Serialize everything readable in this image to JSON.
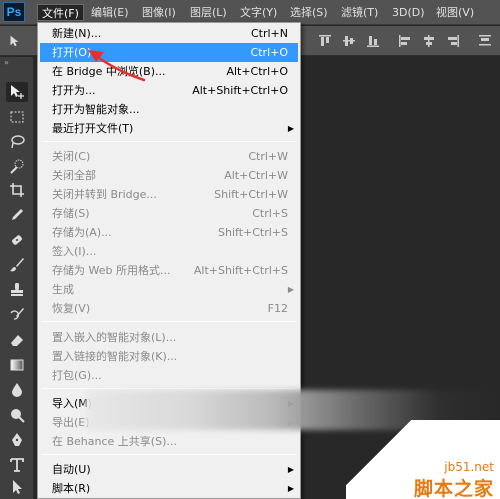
{
  "app": {
    "logo": "Ps"
  },
  "menubar": {
    "items": [
      "文件(F)",
      "编辑(E)",
      "图像(I)",
      "图层(L)",
      "文字(Y)",
      "选择(S)",
      "滤镜(T)",
      "3D(D)",
      "视图(V)"
    ]
  },
  "file_menu": {
    "groups": [
      [
        {
          "label": "新建(N)...",
          "shortcut": "Ctrl+N",
          "enabled": true
        },
        {
          "label": "打开(O)...",
          "shortcut": "Ctrl+O",
          "enabled": true,
          "highlighted": true
        },
        {
          "label": "在 Bridge 中浏览(B)...",
          "shortcut": "Alt+Ctrl+O",
          "enabled": true
        },
        {
          "label": "打开为...",
          "shortcut": "Alt+Shift+Ctrl+O",
          "enabled": true
        },
        {
          "label": "打开为智能对象...",
          "shortcut": "",
          "enabled": true
        },
        {
          "label": "最近打开文件(T)",
          "shortcut": "",
          "enabled": true,
          "submenu": true
        }
      ],
      [
        {
          "label": "关闭(C)",
          "shortcut": "Ctrl+W",
          "enabled": false
        },
        {
          "label": "关闭全部",
          "shortcut": "Alt+Ctrl+W",
          "enabled": false
        },
        {
          "label": "关闭并转到 Bridge...",
          "shortcut": "Shift+Ctrl+W",
          "enabled": false
        },
        {
          "label": "存储(S)",
          "shortcut": "Ctrl+S",
          "enabled": false
        },
        {
          "label": "存储为(A)...",
          "shortcut": "Shift+Ctrl+S",
          "enabled": false
        },
        {
          "label": "签入(I)...",
          "shortcut": "",
          "enabled": false
        },
        {
          "label": "存储为 Web 所用格式...",
          "shortcut": "Alt+Shift+Ctrl+S",
          "enabled": false
        },
        {
          "label": "生成",
          "shortcut": "",
          "enabled": false,
          "submenu": true
        },
        {
          "label": "恢复(V)",
          "shortcut": "F12",
          "enabled": false
        }
      ],
      [
        {
          "label": "置入嵌入的智能对象(L)...",
          "shortcut": "",
          "enabled": false
        },
        {
          "label": "置入链接的智能对象(K)...",
          "shortcut": "",
          "enabled": false
        },
        {
          "label": "打包(G)...",
          "shortcut": "",
          "enabled": false
        }
      ],
      [
        {
          "label": "导入(M)",
          "shortcut": "",
          "enabled": true,
          "submenu": true
        },
        {
          "label": "导出(E)",
          "shortcut": "",
          "enabled": false,
          "submenu": true
        },
        {
          "label": "在 Behance 上共享(S)...",
          "shortcut": "",
          "enabled": false
        }
      ],
      [
        {
          "label": "自动(U)",
          "shortcut": "",
          "enabled": true,
          "submenu": true
        },
        {
          "label": "脚本(R)",
          "shortcut": "",
          "enabled": true,
          "submenu": true
        }
      ]
    ]
  },
  "watermark": {
    "url": "jb51.net",
    "text": "脚本之家"
  },
  "colors": {
    "highlight": "#3399ff",
    "annotation": "#e8302a",
    "watermark": "#e87a10"
  }
}
